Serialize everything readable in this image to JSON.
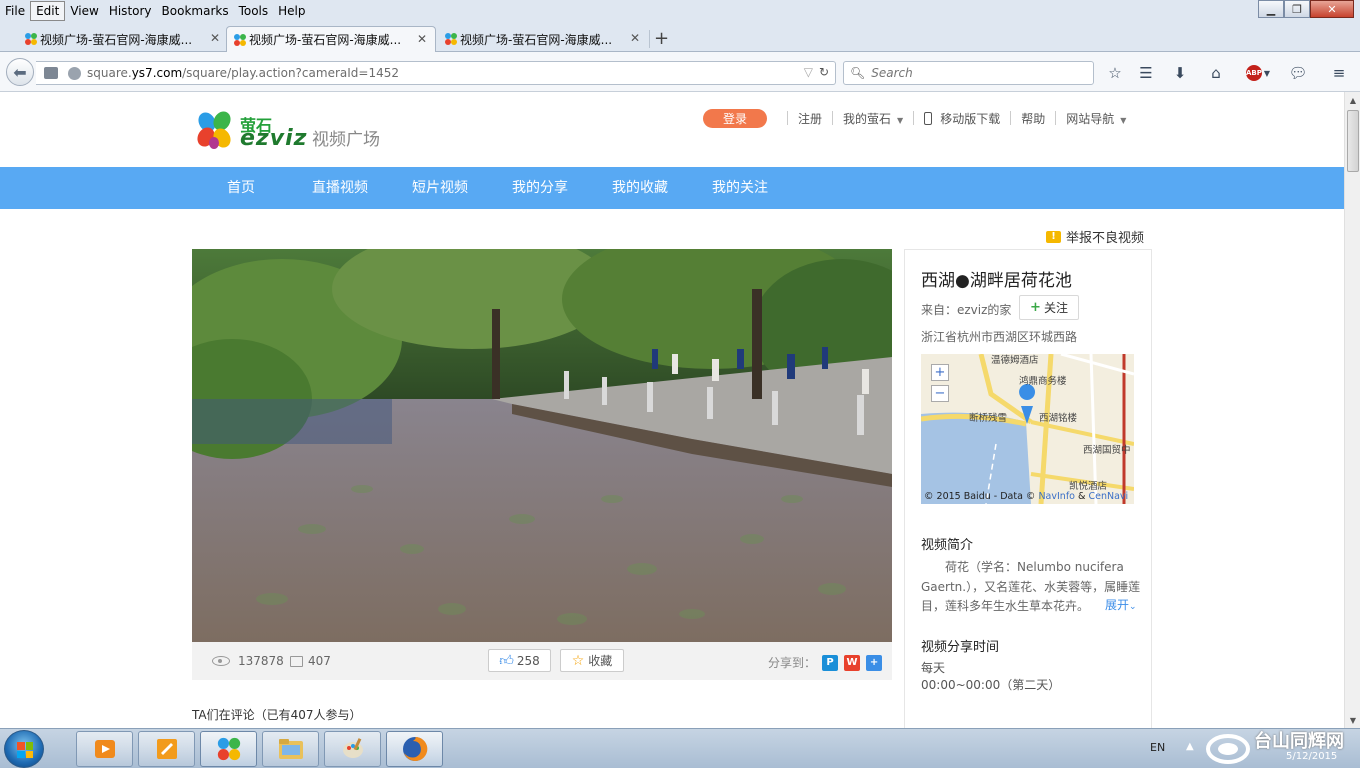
{
  "browser": {
    "menu": [
      {
        "label": "File"
      },
      {
        "label": "Edit"
      },
      {
        "label": "View"
      },
      {
        "label": "History"
      },
      {
        "label": "Bookmarks"
      },
      {
        "label": "Tools"
      },
      {
        "label": "Help"
      }
    ],
    "tabs": [
      {
        "label": "视频广场-萤石官网-海康威..."
      },
      {
        "label": "视频广场-萤石官网-海康威..."
      },
      {
        "label": "视频广场-萤石官网-海康威..."
      }
    ],
    "url_host": "square.",
    "url_domain": "ys7.com",
    "url_path": "/square/play.action?cameraId=1452",
    "search_placeholder": "Search",
    "abp_label": "ABP"
  },
  "site": {
    "brand_cn": "萤石",
    "brand_en": "ezviz",
    "brand_sub": "视频广场",
    "login": "登录",
    "register": "注册",
    "my_ezviz": "我的萤石",
    "mobile_download": "移动版下载",
    "help": "帮助",
    "site_nav": "网站导航",
    "nav": [
      {
        "label": "首页"
      },
      {
        "label": "直播视频"
      },
      {
        "label": "短片视频"
      },
      {
        "label": "我的分享"
      },
      {
        "label": "我的收藏"
      },
      {
        "label": "我的关注"
      }
    ],
    "report": "举报不良视频"
  },
  "video": {
    "views": "137878",
    "comments": "407",
    "likes": "258",
    "favorite": "收藏",
    "share_to": "分享到："
  },
  "comments_title": "TA们在评论（已有407人参与）",
  "side": {
    "title": "西湖●湖畔居荷花池",
    "from": "来自：ezviz的家",
    "follow": "关注",
    "address": "浙江省杭州市西湖区环城西路",
    "map": {
      "copyright": "© 2015 Baidu - Data ©",
      "navinfo": "NavInfo",
      "amp": "&",
      "cennavi": "CenNavi",
      "labels": [
        "温德姆酒店",
        "鸿鼎商务楼",
        "断桥残雪",
        "西湖铭楼",
        "西湖国贸中",
        "凯悦酒店"
      ]
    },
    "intro_title": "视频简介",
    "intro_text": "荷花（学名：Nelumbo nucifera Gaertn.），又名莲花、水芙蓉等，属睡莲目，莲科多年生水生草本花卉。",
    "expand": "展开",
    "share_time_title": "视频分享时间",
    "share_days": "每天",
    "share_hours": "00:00~00:00（第二天）"
  },
  "taskbar": {
    "lang": "EN"
  },
  "watermark": {
    "cn": "台山同辉网",
    "date": "5/12/2015"
  }
}
